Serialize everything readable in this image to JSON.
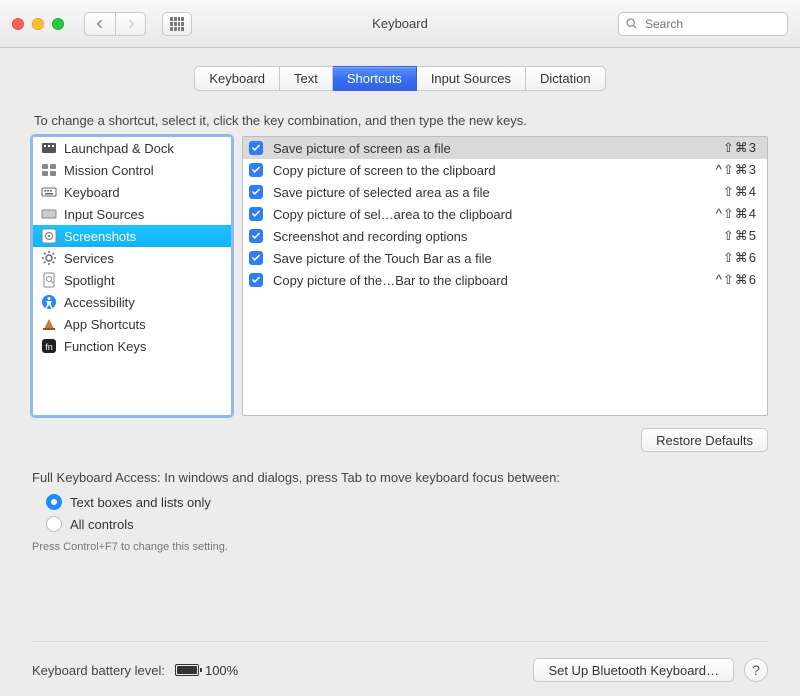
{
  "header": {
    "title": "Keyboard",
    "search_placeholder": "Search"
  },
  "tabs": [
    {
      "label": "Keyboard",
      "active": false
    },
    {
      "label": "Text",
      "active": false
    },
    {
      "label": "Shortcuts",
      "active": true
    },
    {
      "label": "Input Sources",
      "active": false
    },
    {
      "label": "Dictation",
      "active": false
    }
  ],
  "hint": "To change a shortcut, select it, click the key combination, and then type the new keys.",
  "categories": [
    {
      "label": "Launchpad & Dock",
      "icon": "launchpad"
    },
    {
      "label": "Mission Control",
      "icon": "mission"
    },
    {
      "label": "Keyboard",
      "icon": "keyboard"
    },
    {
      "label": "Input Sources",
      "icon": "input"
    },
    {
      "label": "Screenshots",
      "icon": "screenshot",
      "selected": true
    },
    {
      "label": "Services",
      "icon": "gear"
    },
    {
      "label": "Spotlight",
      "icon": "spotlight"
    },
    {
      "label": "Accessibility",
      "icon": "accessibility"
    },
    {
      "label": "App Shortcuts",
      "icon": "app"
    },
    {
      "label": "Function Keys",
      "icon": "fn"
    }
  ],
  "shortcuts": [
    {
      "checked": true,
      "label": "Save picture of screen as a file",
      "key": "⇧⌘3",
      "selected": true
    },
    {
      "checked": true,
      "label": "Copy picture of screen to the clipboard",
      "key": "^⇧⌘3"
    },
    {
      "checked": true,
      "label": "Save picture of selected area as a file",
      "key": "⇧⌘4"
    },
    {
      "checked": true,
      "label": "Copy picture of sel…area to the clipboard",
      "key": "^⇧⌘4"
    },
    {
      "checked": true,
      "label": "Screenshot and recording options",
      "key": "⇧⌘5"
    },
    {
      "checked": true,
      "label": "Save picture of the Touch Bar as a file",
      "key": "⇧⌘6"
    },
    {
      "checked": true,
      "label": "Copy picture of the…Bar to the clipboard",
      "key": "^⇧⌘6"
    }
  ],
  "restore_label": "Restore Defaults",
  "fka": {
    "title": "Full Keyboard Access: In windows and dialogs, press Tab to move keyboard focus between:",
    "options": [
      {
        "label": "Text boxes and lists only",
        "checked": true
      },
      {
        "label": "All controls",
        "checked": false
      }
    ],
    "footnote": "Press Control+F7 to change this setting."
  },
  "footer": {
    "battery_label": "Keyboard battery level:",
    "battery_pct_text": "100%",
    "battery_pct": 100,
    "bluetooth_label": "Set Up Bluetooth Keyboard…",
    "help": "?"
  }
}
